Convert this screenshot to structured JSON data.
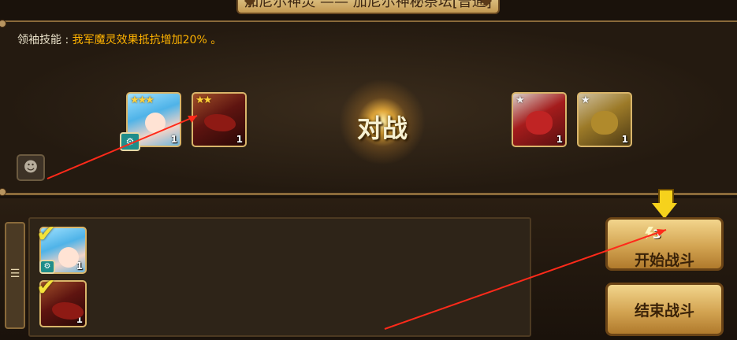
{
  "header": {
    "title": "加尼尔神灵 —— 加尼尔神秘祭坛[普通]"
  },
  "leader_skill": {
    "label": "领袖技能 : ",
    "effect": "我军魔灵效果抵抗增加20% 。"
  },
  "vs_label": "对战",
  "my_team": [
    {
      "name": "blue-mermaid-hero",
      "stars": "★★★",
      "level": "1",
      "rune": "⚙"
    },
    {
      "name": "red-dragon-hero",
      "stars": "★★",
      "level": "1"
    }
  ],
  "enemy_team": [
    {
      "name": "red-boar-enemy",
      "stars": "★",
      "level": "1"
    },
    {
      "name": "gold-boar-enemy",
      "stars": "★",
      "level": "1"
    }
  ],
  "roster": [
    {
      "name": "roster-blue-mermaid",
      "check": "✔",
      "level": "1",
      "rune": "⚙"
    },
    {
      "name": "roster-red-dragon",
      "check": "✔",
      "level": "1"
    }
  ],
  "buttons": {
    "start_label": "开始战斗",
    "start_cost": "3",
    "end_label": "结束战斗"
  },
  "icons": {
    "chat": "☻",
    "filter": "☰"
  },
  "colors": {
    "accent": "#ffb300",
    "arrow": "#ff2a1a"
  }
}
